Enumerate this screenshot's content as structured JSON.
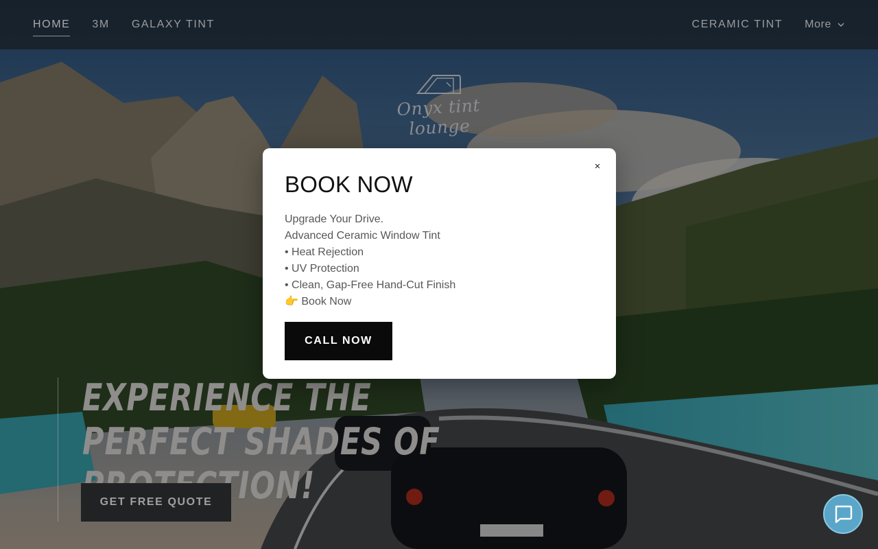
{
  "nav": {
    "left": [
      {
        "label": "HOME",
        "active": true
      },
      {
        "label": "3M",
        "active": false
      },
      {
        "label": "GALAXY TINT",
        "active": false
      }
    ],
    "right": [
      {
        "label": "CERAMIC TINT"
      }
    ],
    "more_label": "More"
  },
  "logo": {
    "text": "Onyx tint lounge",
    "icon": "car-window-icon"
  },
  "hero": {
    "title": "EXPERIENCE THE PERFECT SHADES OF PROTECTION!",
    "cta_label": "GET FREE QUOTE"
  },
  "modal": {
    "title": "BOOK NOW",
    "lines": [
      "Upgrade Your Drive.",
      "Advanced Ceramic Window Tint",
      "• Heat Rejection",
      "• UV Protection",
      "• Clean, Gap-Free Hand-Cut Finish",
      "👉 Book Now"
    ],
    "cta_label": "CALL NOW",
    "close_glyph": "×"
  },
  "chat": {
    "icon": "chat-bubble-icon"
  },
  "colors": {
    "overlay": "#000000",
    "header_bg": "#161a1e",
    "button_dark": "#0a0a0a",
    "chat_accent": "#5aa6c9"
  }
}
